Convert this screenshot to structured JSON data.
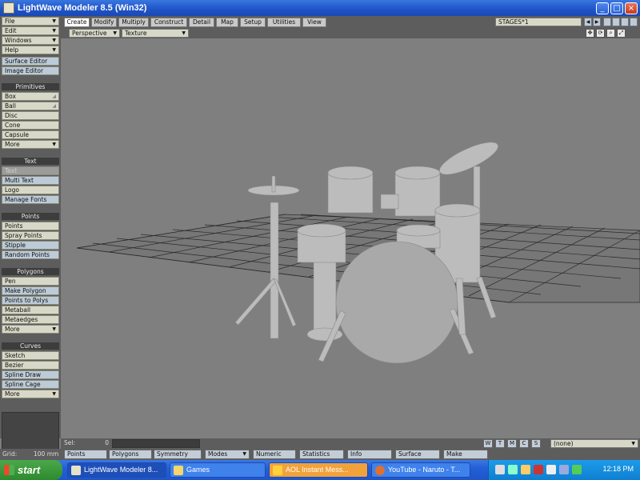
{
  "window": {
    "title": "LightWave Modeler 8.5 (Win32)"
  },
  "left_panel": {
    "menus": [
      {
        "label": "File"
      },
      {
        "label": "Edit"
      },
      {
        "label": "Windows"
      },
      {
        "label": "Help"
      }
    ],
    "editors": [
      {
        "label": "Surface Editor"
      },
      {
        "label": "Image Editor"
      }
    ],
    "sections": {
      "primitives": {
        "header": "Primitives",
        "items": [
          {
            "label": "Box"
          },
          {
            "label": "Ball"
          },
          {
            "label": "Disc"
          },
          {
            "label": "Cone"
          },
          {
            "label": "Capsule"
          },
          {
            "label": "More"
          }
        ]
      },
      "text": {
        "header": "Text",
        "items": [
          {
            "label": "Text"
          },
          {
            "label": "Multi Text"
          },
          {
            "label": "Logo"
          },
          {
            "label": "Manage Fonts"
          }
        ]
      },
      "points": {
        "header": "Points",
        "items": [
          {
            "label": "Points"
          },
          {
            "label": "Spray Points"
          },
          {
            "label": "Stipple"
          },
          {
            "label": "Random Points"
          }
        ]
      },
      "polygons": {
        "header": "Polygons",
        "items": [
          {
            "label": "Pen"
          },
          {
            "label": "Make Polygon"
          },
          {
            "label": "Points to Polys"
          },
          {
            "label": "Metaball"
          },
          {
            "label": "Metaedges"
          },
          {
            "label": "More"
          }
        ]
      },
      "curves": {
        "header": "Curves",
        "items": [
          {
            "label": "Sketch"
          },
          {
            "label": "Bezier"
          },
          {
            "label": "Spline Draw"
          },
          {
            "label": "Spline Cage"
          },
          {
            "label": "More"
          }
        ]
      }
    }
  },
  "tabs": [
    {
      "label": "Create",
      "active": true
    },
    {
      "label": "Modify"
    },
    {
      "label": "Multiply"
    },
    {
      "label": "Construct"
    },
    {
      "label": "Detail"
    },
    {
      "label": "Map"
    },
    {
      "label": "Setup"
    },
    {
      "label": "Utilities"
    },
    {
      "label": "View"
    }
  ],
  "stages_dropdown": "STAGES*1",
  "viewport": {
    "view_mode": "Perspective",
    "render_mode": "Texture"
  },
  "status": {
    "sel_label": "Sel:",
    "sel_count": "0",
    "mode_buttons": [
      "W",
      "T",
      "M",
      "C",
      "S"
    ],
    "layer_dropdown": "(none)",
    "grid_label": "Grid:",
    "grid_value": "100 mm",
    "bottom_buttons": [
      {
        "label": "Points"
      },
      {
        "label": "Polygons"
      },
      {
        "label": "Symmetry"
      },
      {
        "label": "Modes"
      },
      {
        "label": "Numeric"
      },
      {
        "label": "Statistics"
      },
      {
        "label": "Info"
      },
      {
        "label": "Surface"
      },
      {
        "label": "Make"
      }
    ]
  },
  "taskbar": {
    "start_label": "start",
    "tasks": [
      {
        "label": "LightWave Modeler 8..."
      },
      {
        "label": "Games"
      },
      {
        "label": "AOL Instant Mess..."
      },
      {
        "label": "YouTube - Naruto - T..."
      }
    ],
    "clock": "12:18 PM"
  }
}
